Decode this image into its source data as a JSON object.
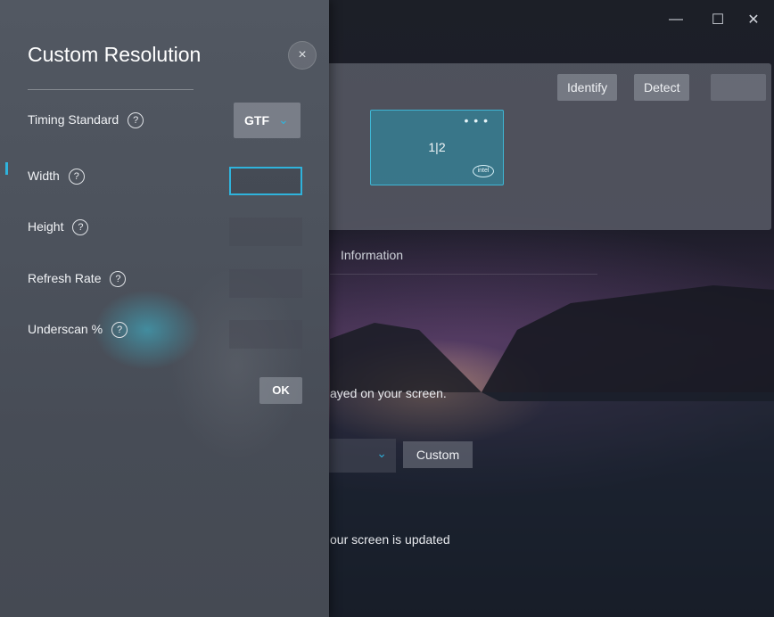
{
  "window": {
    "minimize_glyph": "—",
    "maximize_glyph": "☐",
    "close_glyph": "✕"
  },
  "display": {
    "identify_label": "Identify",
    "detect_label": "Detect",
    "monitor_label": "1|2",
    "monitor_menu": "• • •",
    "monitor_brand": "intel",
    "info_tab": "Information",
    "description_1": "ayed on your screen.",
    "custom_button": "Custom",
    "description_2": "our screen is updated"
  },
  "dialog": {
    "title": "Custom Resolution",
    "close_icon": "close-icon",
    "close_glyph": "×",
    "help_glyph": "?",
    "timing_standard": {
      "label": "Timing Standard",
      "value": "GTF"
    },
    "width": {
      "label": "Width",
      "value": ""
    },
    "height": {
      "label": "Height",
      "value": ""
    },
    "refresh_rate": {
      "label": "Refresh Rate",
      "value": ""
    },
    "underscan": {
      "label": "Underscan %",
      "value": ""
    },
    "ok_label": "OK"
  },
  "colors": {
    "accent": "#2fb3dc",
    "panel": "#4c525c"
  }
}
